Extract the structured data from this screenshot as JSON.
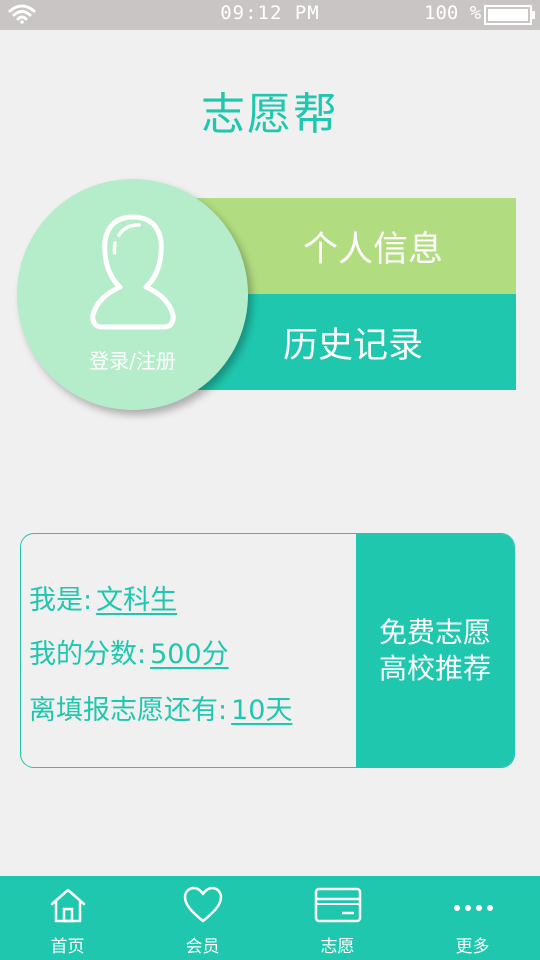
{
  "status_bar": {
    "time": "09:12 PM",
    "battery": "100 %"
  },
  "header": {
    "title": "志愿帮"
  },
  "profile": {
    "login_label": "登录/注册",
    "personal_info_label": "个人信息",
    "history_label": "历史记录"
  },
  "info_card": {
    "row1_label": "我是:",
    "row1_value": "文科生",
    "row2_label": "我的分数:",
    "row2_value": "500分",
    "row3_label": "离填报志愿还有:",
    "row3_value": "10天",
    "cta_line1": "免费志愿",
    "cta_line2": "高校推荐"
  },
  "tabbar": {
    "tabs": [
      {
        "label": "首页",
        "icon": "home-icon"
      },
      {
        "label": "会员",
        "icon": "heart-icon"
      },
      {
        "label": "志愿",
        "icon": "card-icon"
      },
      {
        "label": "更多",
        "icon": "more-icon"
      }
    ]
  },
  "colors": {
    "accent": "#1fc7ae",
    "light_green": "#b1dd80",
    "avatar_bg": "#b5ecc9",
    "status_bar": "#c9c5c4",
    "background": "#f1f0f0"
  }
}
